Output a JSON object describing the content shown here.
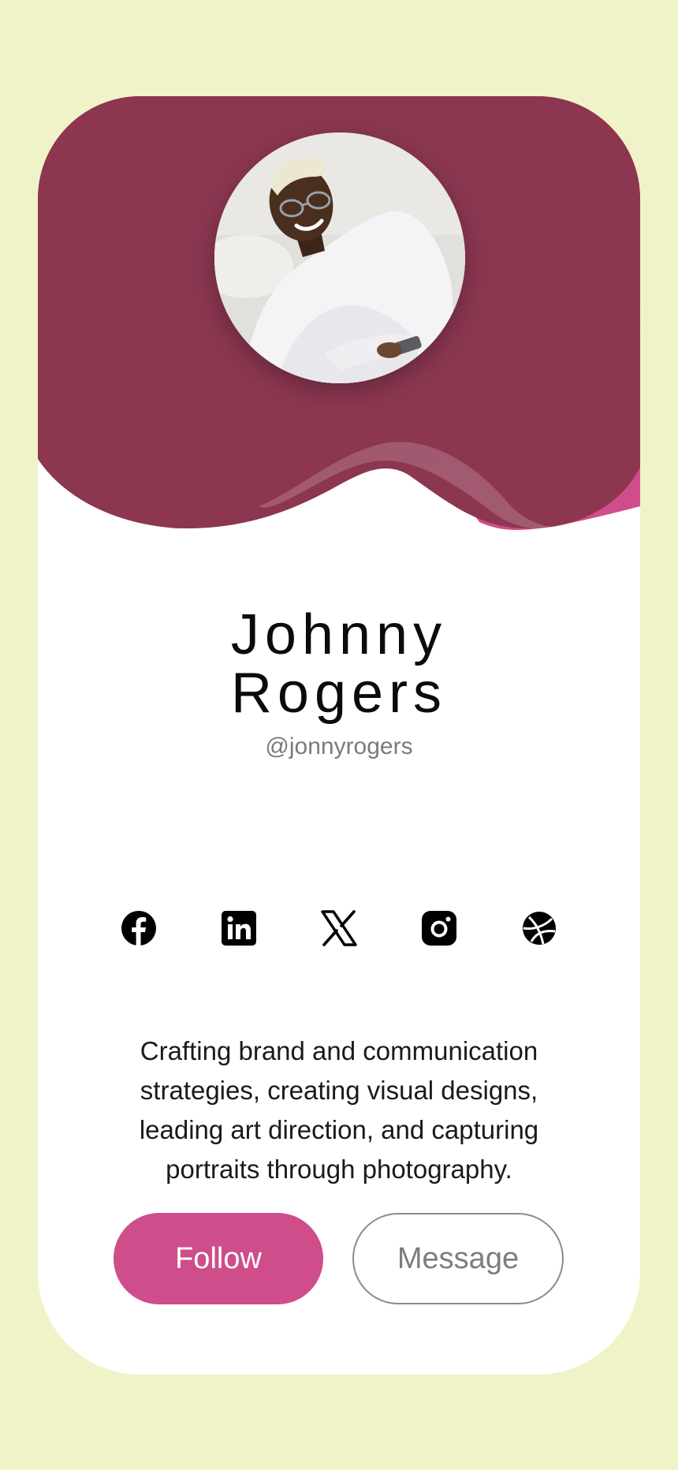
{
  "profile": {
    "first_name": "Johnny",
    "last_name": "Rogers",
    "handle": "@jonnyrogers",
    "bio": "Crafting brand and communication strategies, creating visual designs, leading art direction, and capturing portraits through photography.",
    "avatar_alt": "Profile photo"
  },
  "social_links": [
    {
      "label": "Facebook",
      "icon": "facebook-icon"
    },
    {
      "label": "LinkedIn",
      "icon": "linkedin-icon"
    },
    {
      "label": "X",
      "icon": "x-icon"
    },
    {
      "label": "Instagram",
      "icon": "instagram-icon"
    },
    {
      "label": "Dribbble",
      "icon": "dribbble-icon"
    }
  ],
  "actions": {
    "follow_label": "Follow",
    "message_label": "Message"
  },
  "colors": {
    "page_background": "#f0f3c7",
    "header": "#8e3650",
    "accent": "#ce4d8a",
    "card": "#ffffff"
  }
}
